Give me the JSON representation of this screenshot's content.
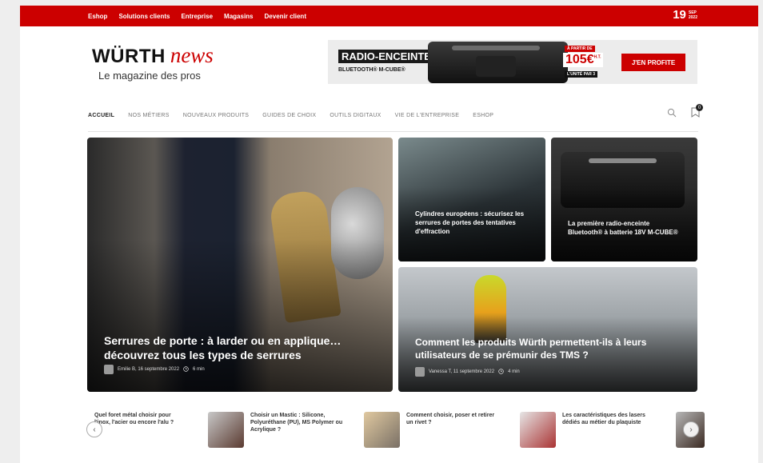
{
  "topbar": {
    "links": [
      "Eshop",
      "Solutions clients",
      "Entreprise",
      "Magasins",
      "Devenir client"
    ],
    "date_day": "19",
    "date_month": "SEP",
    "date_year": "2022"
  },
  "logo": {
    "brand": "WÜRTH",
    "news": "news",
    "tagline": "Le magazine des pros"
  },
  "banner": {
    "title": "RADIO-ENCEINTE",
    "subtitle": "BLUETOOTH® M-CUBE®",
    "price_from": "À PARTIR DE",
    "price": "105€",
    "price_tax": "H.T.",
    "unit": "L'UNITÉ PAR 3",
    "cta": "J'EN PROFITE"
  },
  "nav": {
    "items": [
      "ACCUEIL",
      "NOS MÉTIERS",
      "NOUVEAUX PRODUITS",
      "GUIDES DE CHOIX",
      "OUTILS DIGITAUX",
      "VIE DE L'ENTREPRISE",
      "ESHOP"
    ],
    "cart_count": "0"
  },
  "cards": {
    "main": {
      "title": "Serrures de porte : à larder ou en applique… découvrez tous les types de serrures",
      "author_date": "Emilie B, 16 septembre 2022",
      "read_time": "6 min"
    },
    "lock": {
      "title": "Cylindres européens : sécurisez les serrures de portes des tentatives d'effraction"
    },
    "radio": {
      "title": "La première radio-enceinte Bluetooth® à batterie 18V M-CUBE®"
    },
    "tms": {
      "title": "Comment les produits Würth permettent-ils à leurs utilisateurs de se prémunir des TMS ?",
      "author_date": "Vanessa T, 11 septembre 2022",
      "read_time": "4 min"
    }
  },
  "carousel": {
    "items": [
      "Quel foret métal choisir pour l'inox, l'acier ou encore l'alu ?",
      "Choisir un Mastic : Silicone, Polyuréthane (PU), MS Polymer ou Acrylique ?",
      "Comment choisir, poser et retirer un rivet ?",
      "Les caractéristiques des lasers dédiés au métier du plaquiste"
    ],
    "prev_icon": "arrow-left-icon",
    "next_icon": "arrow-right-icon"
  },
  "colors": {
    "brand_red": "#cc0000"
  }
}
